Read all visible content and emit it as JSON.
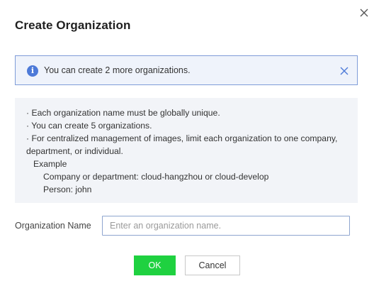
{
  "dialog": {
    "title": "Create Organization",
    "close_icon": "close-icon"
  },
  "banner": {
    "icon": "info-icon",
    "icon_glyph": "i",
    "text": "You can create 2 more organizations.",
    "close_icon": "close-icon"
  },
  "hints": {
    "lines": [
      "· Each organization name must be globally unique.",
      "· You can create 5 organizations.",
      "· For centralized management of images, limit each organization to one company,",
      "department, or individual."
    ],
    "example_label": "Example",
    "examples": [
      "Company or department: cloud-hangzhou or cloud-develop",
      "Person: john"
    ]
  },
  "form": {
    "name_label": "Organization Name",
    "name_value": "",
    "name_placeholder": "Enter an organization name."
  },
  "buttons": {
    "ok": "OK",
    "cancel": "Cancel"
  },
  "colors": {
    "banner_border": "#7f9cd8",
    "banner_bg": "#eff3fb",
    "info_icon": "#4d7ad8",
    "hint_bg": "#f2f4f8",
    "ok_bg": "#1fd140"
  }
}
